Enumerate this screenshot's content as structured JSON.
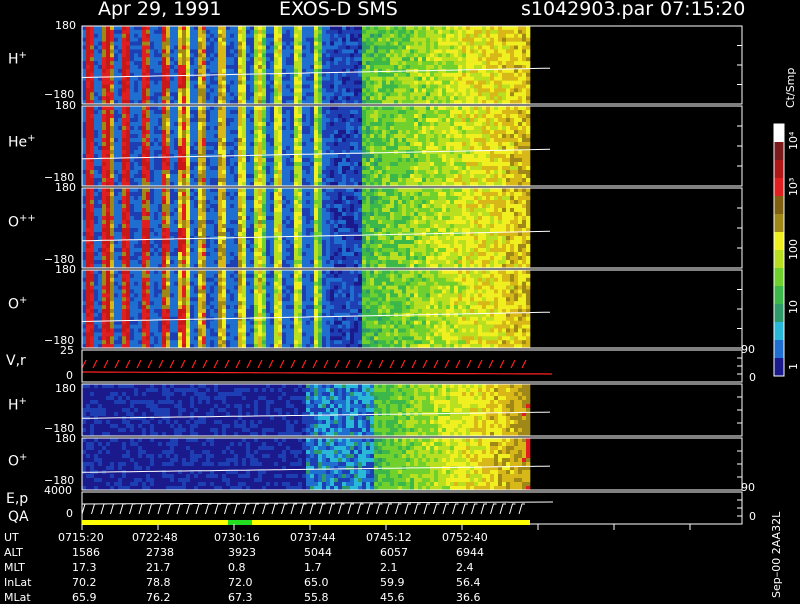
{
  "header": {
    "date": "Apr 29, 1991",
    "instrument": "EXOS-D SMS",
    "file": "s1042903.par",
    "time": "07:15:20"
  },
  "colors": {
    "background": "#000000",
    "trace": "#ffffff",
    "velocity_trace": "#ff2020",
    "qa_bar": "#ffff00",
    "qa_green": "#22dd22"
  },
  "panels": [
    {
      "id": "h-plus",
      "name": "H",
      "charge": "+",
      "ymax": "180",
      "ymin": "−180"
    },
    {
      "id": "he-plus",
      "name": "He",
      "charge": "+",
      "ymax": "180",
      "ymin": "−180"
    },
    {
      "id": "o-plusplus",
      "name": "O",
      "charge": "++",
      "ymax": "180",
      "ymin": "−180"
    },
    {
      "id": "o-plus",
      "name": "O",
      "charge": "+",
      "ymax": "180",
      "ymin": "−180"
    }
  ],
  "vr_panel": {
    "label": "V,r",
    "ymax": "25",
    "ymin": "0",
    "rmax": "90",
    "rmin": "0"
  },
  "lower_panels": [
    {
      "id": "h-plus-lower",
      "name": "H",
      "charge": "+",
      "ymax": "180",
      "ymin": "−180"
    },
    {
      "id": "o-plus-lower",
      "name": "O",
      "charge": "+",
      "ymax": "180",
      "ymin": "−180"
    }
  ],
  "ep_panel": {
    "label1": "E,p",
    "label2": "QA",
    "ymax": "4000",
    "ymin": "0",
    "rmax": "90",
    "rmin": "0"
  },
  "colorbar": {
    "unit": "Ct/Smp",
    "ticks": [
      "10⁴",
      "10³",
      "100",
      "10",
      "1"
    ]
  },
  "footer": {
    "rows": [
      {
        "label": "UT",
        "values": [
          "0715:20",
          "0722:48",
          "0730:16",
          "0737:44",
          "0745:12",
          "0752:40"
        ]
      },
      {
        "label": "ALT",
        "values": [
          "1586",
          "2738",
          "3923",
          "5044",
          "6057",
          "6944"
        ]
      },
      {
        "label": "MLT",
        "values": [
          "17.3",
          "21.7",
          "0.8",
          "1.7",
          "2.1",
          "2.4"
        ]
      },
      {
        "label": "InLat",
        "values": [
          "70.2",
          "78.8",
          "72.0",
          "65.0",
          "59.9",
          "56.4"
        ]
      },
      {
        "label": "MLat",
        "values": [
          "65.9",
          "76.2",
          "67.3",
          "55.8",
          "45.6",
          "36.6"
        ]
      }
    ],
    "stamp": "Sep–00  2AA32L"
  },
  "chart_data": {
    "type": "heatmap",
    "title": "Apr 29, 1991    EXOS-D SMS",
    "xlabel": "UT",
    "x_ticks": [
      "0715:20",
      "0722:48",
      "0730:16",
      "0737:44",
      "0745:12",
      "0752:40"
    ],
    "ylim": [
      -180,
      180
    ],
    "colorbar_unit": "Ct/Smp",
    "colorbar_scale": "log",
    "colorbar_range": [
      1,
      10000
    ],
    "series": [
      {
        "name": "H+",
        "ylim": [
          -180,
          180
        ]
      },
      {
        "name": "He+",
        "ylim": [
          -180,
          180
        ]
      },
      {
        "name": "O++",
        "ylim": [
          -180,
          180
        ]
      },
      {
        "name": "O+",
        "ylim": [
          -180,
          180
        ]
      },
      {
        "name": "V,r",
        "ylim": [
          0,
          25
        ]
      },
      {
        "name": "H+",
        "ylim": [
          -180,
          180
        ]
      },
      {
        "name": "O+",
        "ylim": [
          -180,
          180
        ]
      },
      {
        "name": "E,p",
        "ylim": [
          0,
          4000
        ]
      }
    ]
  }
}
